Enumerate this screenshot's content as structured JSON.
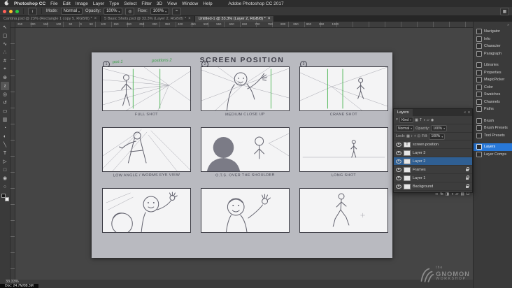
{
  "menubar": {
    "title": "Adobe Photoshop CC 2017",
    "items": [
      "Photoshop CC",
      "File",
      "Edit",
      "Image",
      "Layer",
      "Type",
      "Select",
      "Filter",
      "3D",
      "View",
      "Window",
      "Help"
    ]
  },
  "options_bar": {
    "tool_glyph": "≀",
    "mode_label": "Mode:",
    "mode_value": "Normal",
    "opacity_label": "Opacity:",
    "opacity_value": "100%",
    "flow_label": "Flow:",
    "flow_value": "100%",
    "workspace_glyph": "▦"
  },
  "tabs": [
    {
      "label": "Cantina.psd @ 23% (Rectangle 1 copy 5, RGB/8) *"
    },
    {
      "label": "5 Basic Shots.psd @ 33.3% (Layer 2, RGB/8) *"
    },
    {
      "label": "Untitled-1 @ 33.3% (Layer 2, RGB/8) *"
    }
  ],
  "ruler": {
    "h_numbers": "250 200 150 100 50 0 50 100 150 200 250 300 350 400 450 500 550 600 650 700 750 800 850 900 950 1000"
  },
  "toolbar": {
    "tools": [
      {
        "name": "move",
        "glyph": "↖"
      },
      {
        "name": "marquee",
        "glyph": "▢"
      },
      {
        "name": "lasso",
        "glyph": "∿"
      },
      {
        "name": "quick-selection",
        "glyph": "∴"
      },
      {
        "name": "crop",
        "glyph": "#"
      },
      {
        "name": "eyedropper",
        "glyph": "⌖"
      },
      {
        "name": "healing-brush",
        "glyph": "⊕"
      },
      {
        "name": "brush",
        "glyph": "≀"
      },
      {
        "name": "clone-stamp",
        "glyph": "◎"
      },
      {
        "name": "history-brush",
        "glyph": "↺"
      },
      {
        "name": "eraser",
        "glyph": "▭"
      },
      {
        "name": "gradient",
        "glyph": "▥"
      },
      {
        "name": "blur",
        "glyph": "◔"
      },
      {
        "name": "dodge",
        "glyph": "◐"
      },
      {
        "name": "pen",
        "glyph": "╲"
      },
      {
        "name": "type",
        "glyph": "T"
      },
      {
        "name": "path-selection",
        "glyph": "▷"
      },
      {
        "name": "shape",
        "glyph": "□"
      },
      {
        "name": "hand",
        "glyph": "◉"
      },
      {
        "name": "zoom",
        "glyph": "○"
      }
    ]
  },
  "right_rail": {
    "collapse_glyph": "»",
    "items": [
      "Navigator",
      "Info",
      "Character",
      "Paragraph",
      "Libraries",
      "Properties",
      "MagicPicker",
      "Color",
      "Swatches",
      "Channels",
      "Paths",
      "Brush",
      "Brush Presets",
      "Tool Presets",
      "Layers",
      "Layer Comps"
    ]
  },
  "layers_panel": {
    "title": "Layers",
    "collapse_glyph": "«",
    "menu_glyph": "≡",
    "search_glyph": "⌕",
    "filter_label": "Kind",
    "filter_icons": [
      "▦",
      "T",
      "◑",
      "▱",
      "◉"
    ],
    "blend_mode": "Normal",
    "opacity_label": "Opacity:",
    "opacity_value": "100%",
    "lock_label": "Lock:",
    "lock_icons": [
      "▦",
      "≀",
      "+",
      "⊡"
    ],
    "fill_label": "Fill:",
    "fill_value": "100%",
    "layers": [
      {
        "name": "screen position",
        "thumb": "T",
        "locked": false,
        "selected": false
      },
      {
        "name": "Layer 3",
        "thumb": "",
        "locked": false,
        "selected": false
      },
      {
        "name": "Layer 2",
        "thumb": "",
        "locked": false,
        "selected": true
      },
      {
        "name": "Frames",
        "thumb": "",
        "locked": true,
        "selected": false
      },
      {
        "name": "Layer 1",
        "thumb": "",
        "locked": true,
        "selected": false
      },
      {
        "name": "Background",
        "thumb": "",
        "locked": true,
        "selected": false
      }
    ],
    "footer_icons": [
      "∞",
      "fx",
      "◨",
      "◑",
      "▱",
      "▤",
      "⊔"
    ]
  },
  "canvas": {
    "title": "SCREEN POSITION",
    "notes": {
      "a": "pos 1",
      "b": "positions 2"
    },
    "panel_numbers": [
      "1",
      "2",
      "3"
    ],
    "panels": [
      {
        "caption": "FULL SHOT"
      },
      {
        "caption": "MEDIUM CLOSE UP"
      },
      {
        "caption": "CRANE SHOT"
      },
      {
        "caption": "LOW ANGLE / WORMS EYE VIEW"
      },
      {
        "caption": "O.T.S. OVER THE SHOULDER"
      },
      {
        "caption": "LONG SHOT"
      },
      {
        "caption": ""
      },
      {
        "caption": ""
      },
      {
        "caption": ""
      }
    ]
  },
  "status_bar": {
    "zoom": "33.33%",
    "doc": "Doc: 24.7M/88.3M"
  },
  "watermark": {
    "the": "the",
    "name": "GNOMON",
    "workshop": "WORKSHOP"
  },
  "ui": {
    "close": "×",
    "caret": "▾"
  },
  "colors": {
    "accent_blue": "#2878d8",
    "layer_selection_blue": "#2f5f93",
    "annotation_green": "#3da14a",
    "traffic_red": "#ff5f57",
    "traffic_yellow": "#febc2e",
    "traffic_green": "#28c840"
  }
}
